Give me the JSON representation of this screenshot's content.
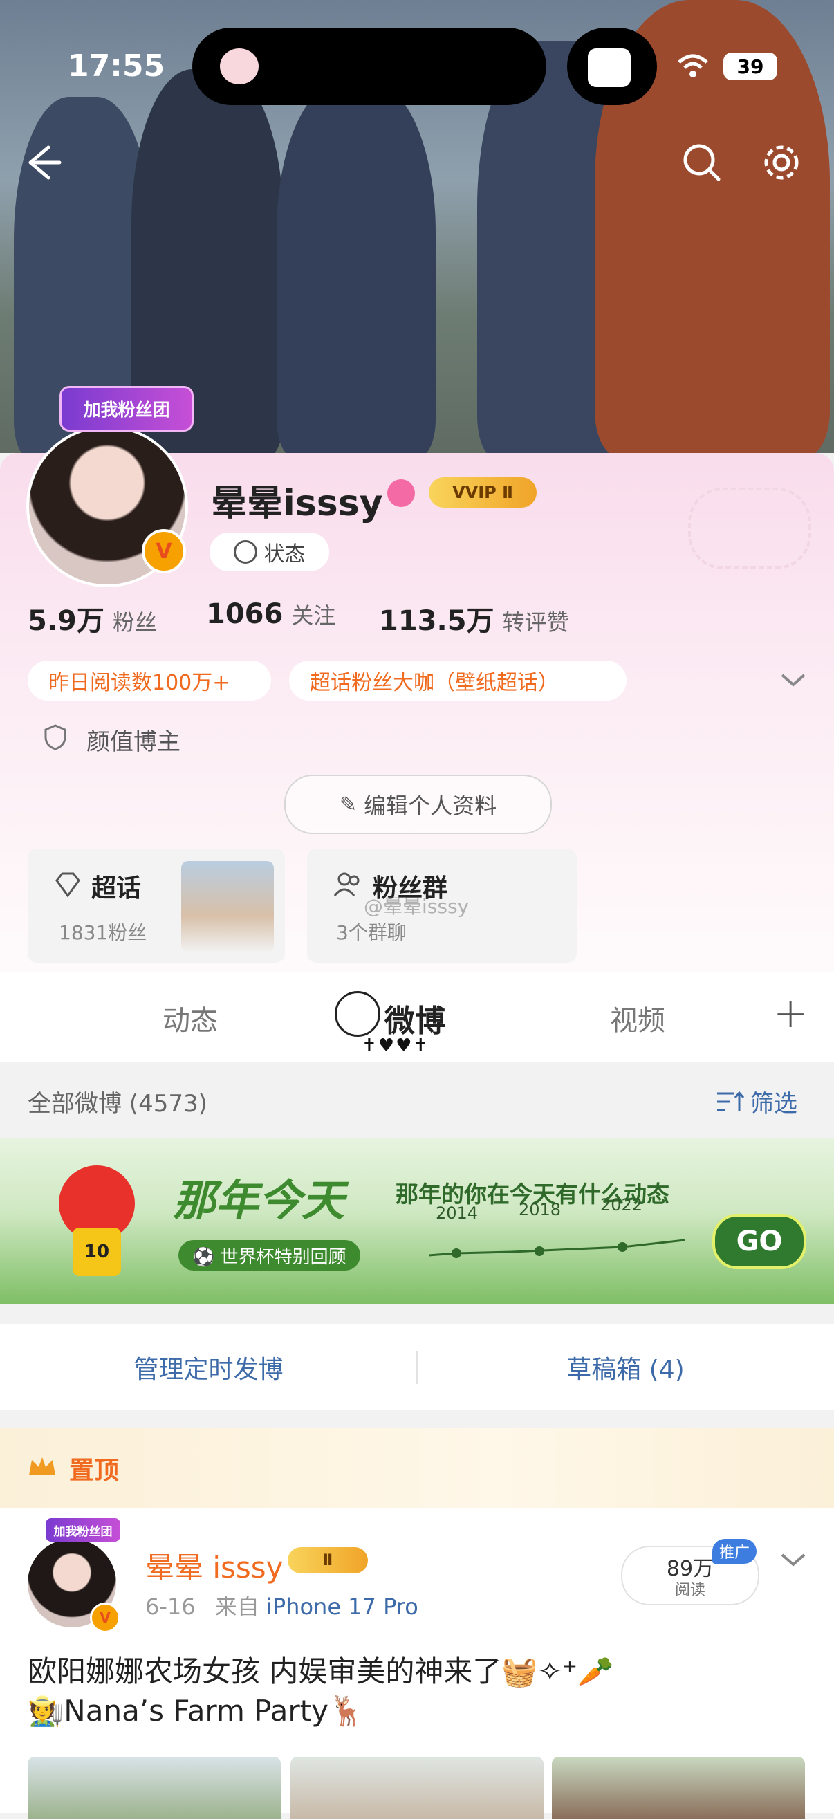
{
  "status_bar": {
    "time": "17:55",
    "battery": "39"
  },
  "profile": {
    "fan_group_tag": "加我粉丝团",
    "verified_badge": "V",
    "username": "晕晕isssy",
    "vip_badge": "VVIP Ⅱ",
    "status_button": "状态",
    "stats": [
      {
        "value": "5.9万",
        "label": "粉丝"
      },
      {
        "value": "1066",
        "label": "关注"
      },
      {
        "value": "113.5万",
        "label": "转评赞"
      }
    ],
    "tags": [
      "昨日阅读数100万+",
      "超话粉丝大咖（壁纸超话）"
    ],
    "identity": "颜值博主",
    "edit_button": "编辑个人资料",
    "supertopic": {
      "title": "超话",
      "sub": "1831粉丝"
    },
    "fan_group": {
      "title": "粉丝群",
      "sub": "3个群聊",
      "watermark": "@晕晕isssy"
    }
  },
  "tabs": {
    "items": [
      "动态",
      "微博",
      "视频"
    ],
    "active": "微博",
    "decoration": "✝♥♥✝",
    "add": "+"
  },
  "list": {
    "title": "全部微博 (4573)",
    "filter": "筛选"
  },
  "banner": {
    "title": "那年今天",
    "subtitle": "那年的你在今天有什么动态",
    "special": "⚽ 世界杯特别回顾",
    "years": [
      "2014",
      "2018",
      "2022"
    ],
    "go": "GO",
    "jersey": "10"
  },
  "actions": {
    "scheduled": "管理定时发博",
    "drafts": "草稿箱 (4)"
  },
  "post": {
    "pinned": "置顶",
    "fan_tag": "加我粉丝团",
    "author": "晕晕 isssy",
    "vip": "Ⅱ",
    "date": "6-16",
    "source_prefix": "来自",
    "source": "iPhone 17 Pro",
    "reads_value": "89万",
    "reads_label": "阅读",
    "promote": "推广",
    "line1": "欧阳娜娜农场女孩 内娱审美的神来了🧺✧⁺🥕",
    "line2": "🧑‍🌾Nana’s Farm Party🦌"
  },
  "colors": {
    "accent_orange": "#f06a1f",
    "link_blue": "#3d6aa8",
    "pink": "#f9dcec"
  }
}
